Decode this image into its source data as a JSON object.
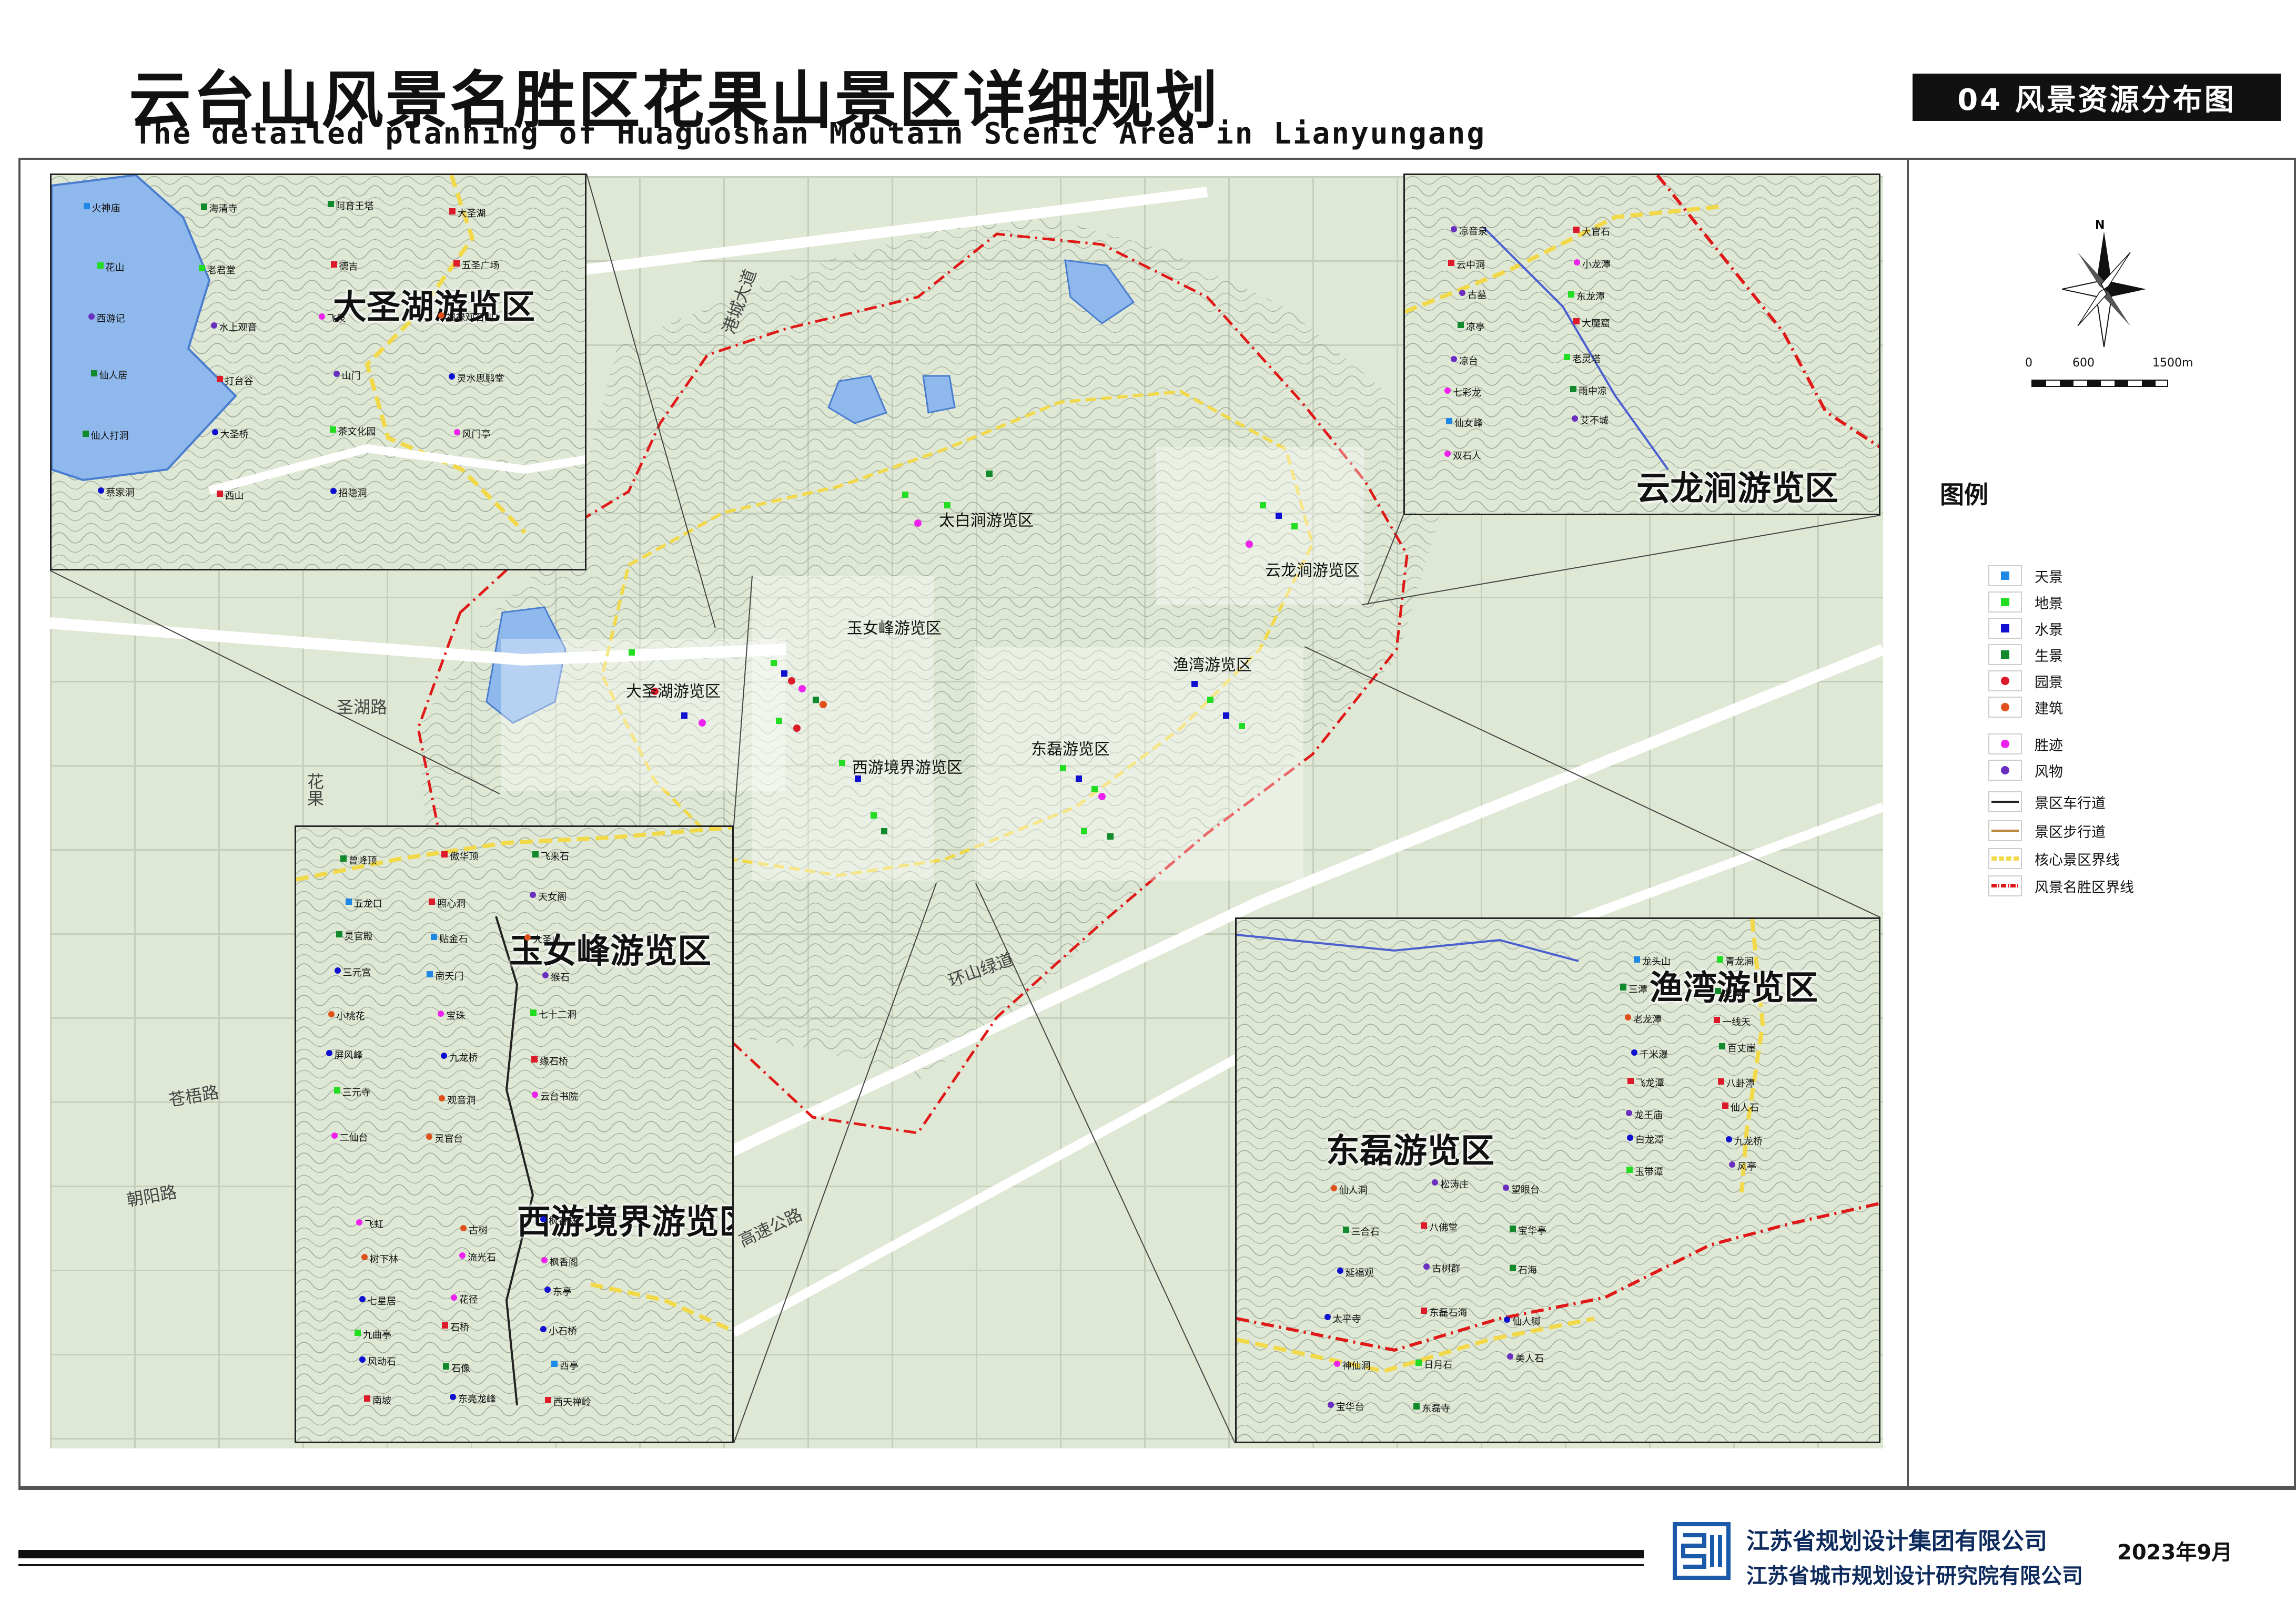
{
  "header": {
    "title_zh": "云台山风景名胜区花果山景区详细规划",
    "title_en": "The detailed planning of Huaguoshan Moutain Scenic Area in Lianyungang",
    "sheet_label": "04  风景资源分布图"
  },
  "footer": {
    "company_1": "江苏省规划设计集团有限公司",
    "company_2": "江苏省城市规划设计研究院有限公司",
    "date": "2023年9月"
  },
  "north": {
    "label": "N"
  },
  "scale": {
    "labels": [
      "0",
      "600",
      "1500m"
    ]
  },
  "legend": {
    "title": "图例",
    "items": [
      {
        "label": "天景",
        "color": "#1e88e5",
        "shape": "square"
      },
      {
        "label": "地景",
        "color": "#22dd22",
        "shape": "square"
      },
      {
        "label": "水景",
        "color": "#1010d0",
        "shape": "square"
      },
      {
        "label": "生景",
        "color": "#108a2a",
        "shape": "square"
      },
      {
        "label": "园景",
        "color": "#dd1a2a",
        "shape": "circle"
      },
      {
        "label": "建筑",
        "color": "#e0501a",
        "shape": "circle"
      },
      {
        "label": "胜迹",
        "color": "#ee22ee",
        "shape": "circle"
      },
      {
        "label": "风物",
        "color": "#6a2fc0",
        "shape": "circle"
      },
      {
        "label": "景区车行道",
        "color": "#222222",
        "shape": "line"
      },
      {
        "label": "景区步行道",
        "color": "#b8863a",
        "shape": "line"
      },
      {
        "label": "核心景区界线",
        "color": "#f2d94a",
        "shape": "dash"
      },
      {
        "label": "风景名胜区界线",
        "color": "#e01818",
        "shape": "dashdot"
      }
    ]
  },
  "main_map": {
    "area_labels": [
      "太白涧游览区",
      "云龙涧游览区",
      "玉女峰游览区",
      "大圣湖游览区",
      "西游境界游览区",
      "东磊游览区",
      "渔湾游览区"
    ],
    "road_labels": [
      "港城大道",
      "圣湖路",
      "花果",
      "环山绿道",
      "高速公路",
      "苍梧路",
      "朝阳路"
    ]
  },
  "panels": {
    "dashenghu": {
      "title": "大圣湖游览区",
      "points": [
        "火神庙",
        "海清寺",
        "阿育王塔",
        "大圣湖",
        "花山",
        "老君堂",
        "德吉",
        "五圣广场",
        "西游记",
        "水上观音",
        "飞泉",
        "福禄观石刻",
        "仙人居",
        "打台谷",
        "山门",
        "灵水思鹏堂",
        "仙人打洞",
        "大圣桥",
        "茶文化园",
        "风门亭",
        "蔡家洞",
        "西山",
        "招隐洞"
      ]
    },
    "yunlongjian": {
      "title": "云龙涧游览区",
      "points": [
        "凉音泉",
        "大官石",
        "云中洞",
        "小龙潭",
        "古墓",
        "东龙潭",
        "凉亭",
        "大魔窟",
        "凉台",
        "老灵塔",
        "七彩龙",
        "雨中凉",
        "仙女峰",
        "艾不城",
        "双石人"
      ]
    },
    "yunvfeng": {
      "title": "玉女峰游览区",
      "points": [
        "曾峰顶",
        "傲华顶",
        "飞来石",
        "五龙口",
        "照心洞",
        "天女阁",
        "灵官殿",
        "贴金石",
        "大圣山",
        "三元宫",
        "南天门",
        "猴石",
        "小桃花",
        "宝珠",
        "七十二洞",
        "屏风峰",
        "九龙桥",
        "缘石桥",
        "三元寺",
        "观音洞",
        "云台书院",
        "二仙台",
        "灵官台"
      ]
    },
    "xiyoujingjie": {
      "title": "西游境界游览区",
      "points": [
        "飞虹",
        "古树",
        "枫香林",
        "树下林",
        "流光石",
        "枫香阁",
        "七星居",
        "花径",
        "东亭",
        "九曲亭",
        "石桥",
        "小石桥",
        "风动石",
        "石像",
        "西亭",
        "南坡",
        "东亮龙峰",
        "西天禅岭"
      ]
    },
    "donglei": {
      "title": "东磊游览区",
      "points": [
        "仙人洞",
        "松涛庄",
        "望眼台",
        "三合石",
        "八佛堂",
        "宝华亭",
        "延福观",
        "古树群",
        "石海",
        "太平寺",
        "东磊石海",
        "仙人脚",
        "神仙洞",
        "日月石",
        "美人石",
        "宝华台",
        "东磊寺"
      ]
    },
    "yuwan": {
      "title": "渔湾游览区",
      "points": [
        "龙头山",
        "青龙涧",
        "三潭",
        "龙潭",
        "老龙潭",
        "一线天",
        "千米瀑",
        "百丈崖",
        "飞龙潭",
        "八卦潭",
        "龙王庙",
        "仙人石",
        "白龙潭",
        "九龙桥",
        "玉带潭",
        "风亭"
      ]
    }
  }
}
